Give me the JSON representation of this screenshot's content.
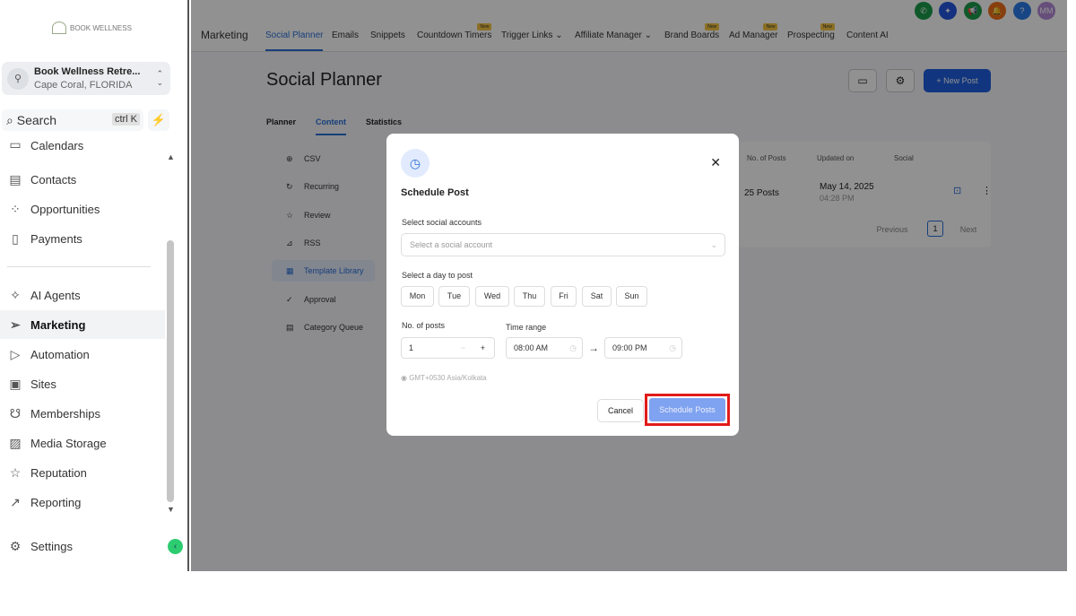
{
  "sidebar": {
    "logo": "BOOK WELLNESS",
    "location": {
      "name": "Book Wellness Retre...",
      "sub": "Cape Coral, FLORIDA"
    },
    "search": {
      "label": "Search",
      "shortcut": "ctrl K"
    },
    "items": [
      {
        "label": "Calendars",
        "icon": "calendar-icon"
      },
      {
        "label": "Contacts",
        "icon": "contacts-icon"
      },
      {
        "label": "Opportunities",
        "icon": "opportunities-icon"
      },
      {
        "label": "Payments",
        "icon": "payments-icon"
      },
      {
        "label": "AI Agents",
        "icon": "sparkle-icon"
      },
      {
        "label": "Marketing",
        "icon": "send-icon"
      },
      {
        "label": "Automation",
        "icon": "automation-icon"
      },
      {
        "label": "Sites",
        "icon": "sites-icon"
      },
      {
        "label": "Memberships",
        "icon": "membership-icon"
      },
      {
        "label": "Media Storage",
        "icon": "image-icon"
      },
      {
        "label": "Reputation",
        "icon": "star-icon"
      },
      {
        "label": "Reporting",
        "icon": "chart-icon"
      }
    ],
    "settings": "Settings"
  },
  "topnav": {
    "section": "Marketing",
    "tabs": [
      {
        "label": "Social Planner"
      },
      {
        "label": "Emails"
      },
      {
        "label": "Snippets"
      },
      {
        "label": "Countdown Timers",
        "badge": "New"
      },
      {
        "label": "Trigger Links ⌄"
      },
      {
        "label": "Affiliate Manager ⌄"
      },
      {
        "label": "Brand Boards",
        "badge": "New"
      },
      {
        "label": "Ad Manager",
        "badge": "New"
      },
      {
        "label": "Prospecting",
        "badge": "New"
      },
      {
        "label": "Content AI"
      }
    ],
    "avatar": "MM"
  },
  "page": {
    "title": "Social Planner",
    "new_post": "New Post",
    "subtabs": [
      "Planner",
      "Content",
      "Statistics"
    ],
    "content_menu": [
      "CSV",
      "Recurring",
      "Review",
      "RSS",
      "Template Library",
      "Approval",
      "Category Queue"
    ],
    "table": {
      "headers": [
        "No. of Posts",
        "Updated on",
        "Social"
      ],
      "row": {
        "posts": "25 Posts",
        "date": "May 14, 2025",
        "time": "04:28 PM"
      },
      "prev": "Previous",
      "page": "1",
      "next": "Next"
    }
  },
  "modal": {
    "title": "Schedule Post",
    "accounts_label": "Select social accounts",
    "accounts_placeholder": "Select a social account",
    "day_label": "Select a day to post",
    "days": [
      "Mon",
      "Tue",
      "Wed",
      "Thu",
      "Fri",
      "Sat",
      "Sun"
    ],
    "posts_label": "No. of posts",
    "posts_value": "1",
    "time_label": "Time range",
    "time_from": "08:00 AM",
    "time_to": "09:00 PM",
    "timezone": "GMT+0530 Asia/Kolkata",
    "cancel": "Cancel",
    "submit": "Schedule Posts"
  },
  "colors": {
    "accent": "#1f5fe0",
    "highlight": "#e21b1b"
  }
}
